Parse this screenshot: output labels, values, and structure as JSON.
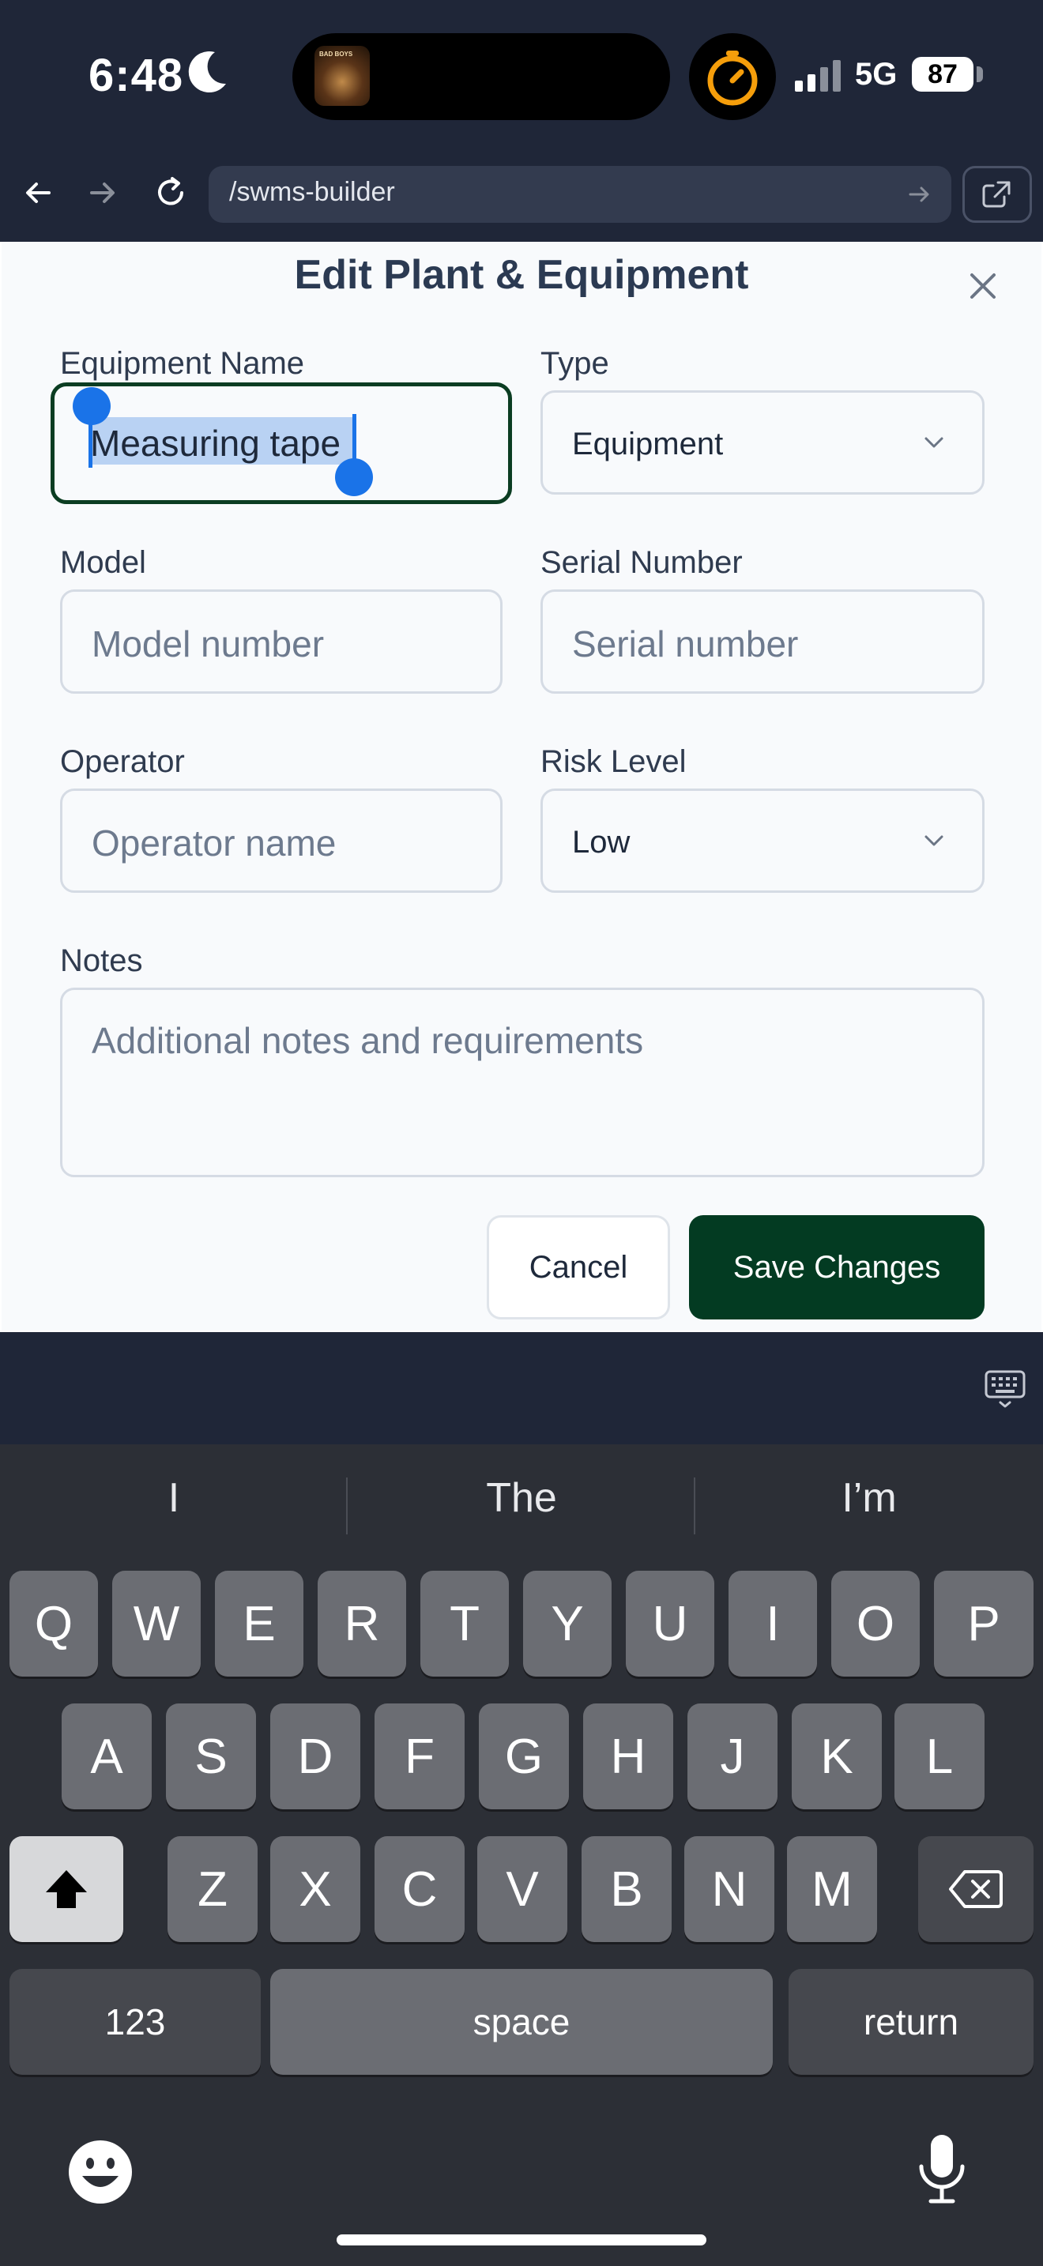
{
  "status_bar": {
    "time": "6:48",
    "network": "5G",
    "battery": "87",
    "island_art_text": "BAD BOYS"
  },
  "browser": {
    "url": "/swms-builder"
  },
  "modal": {
    "title": "Edit Plant & Equipment",
    "fields": {
      "equipment_name": {
        "label": "Equipment Name",
        "value": "Measuring tape"
      },
      "type": {
        "label": "Type",
        "value": "Equipment"
      },
      "model": {
        "label": "Model",
        "placeholder": "Model number"
      },
      "serial_number": {
        "label": "Serial Number",
        "placeholder": "Serial number"
      },
      "operator": {
        "label": "Operator",
        "placeholder": "Operator name"
      },
      "risk_level": {
        "label": "Risk Level",
        "value": "Low"
      },
      "notes": {
        "label": "Notes",
        "placeholder": "Additional notes and requirements"
      }
    },
    "cancel_label": "Cancel",
    "save_label": "Save Changes"
  },
  "keyboard": {
    "suggestions": [
      "I",
      "The",
      "I’m"
    ],
    "row1": [
      "Q",
      "W",
      "E",
      "R",
      "T",
      "Y",
      "U",
      "I",
      "O",
      "P"
    ],
    "row2": [
      "A",
      "S",
      "D",
      "F",
      "G",
      "H",
      "J",
      "K",
      "L"
    ],
    "row3": [
      "Z",
      "X",
      "C",
      "V",
      "B",
      "N",
      "M"
    ],
    "numbers_label": "123",
    "space_label": "space",
    "return_label": "return"
  },
  "colors": {
    "accent_green": "#033b22",
    "selection_blue": "#1a73e8"
  }
}
